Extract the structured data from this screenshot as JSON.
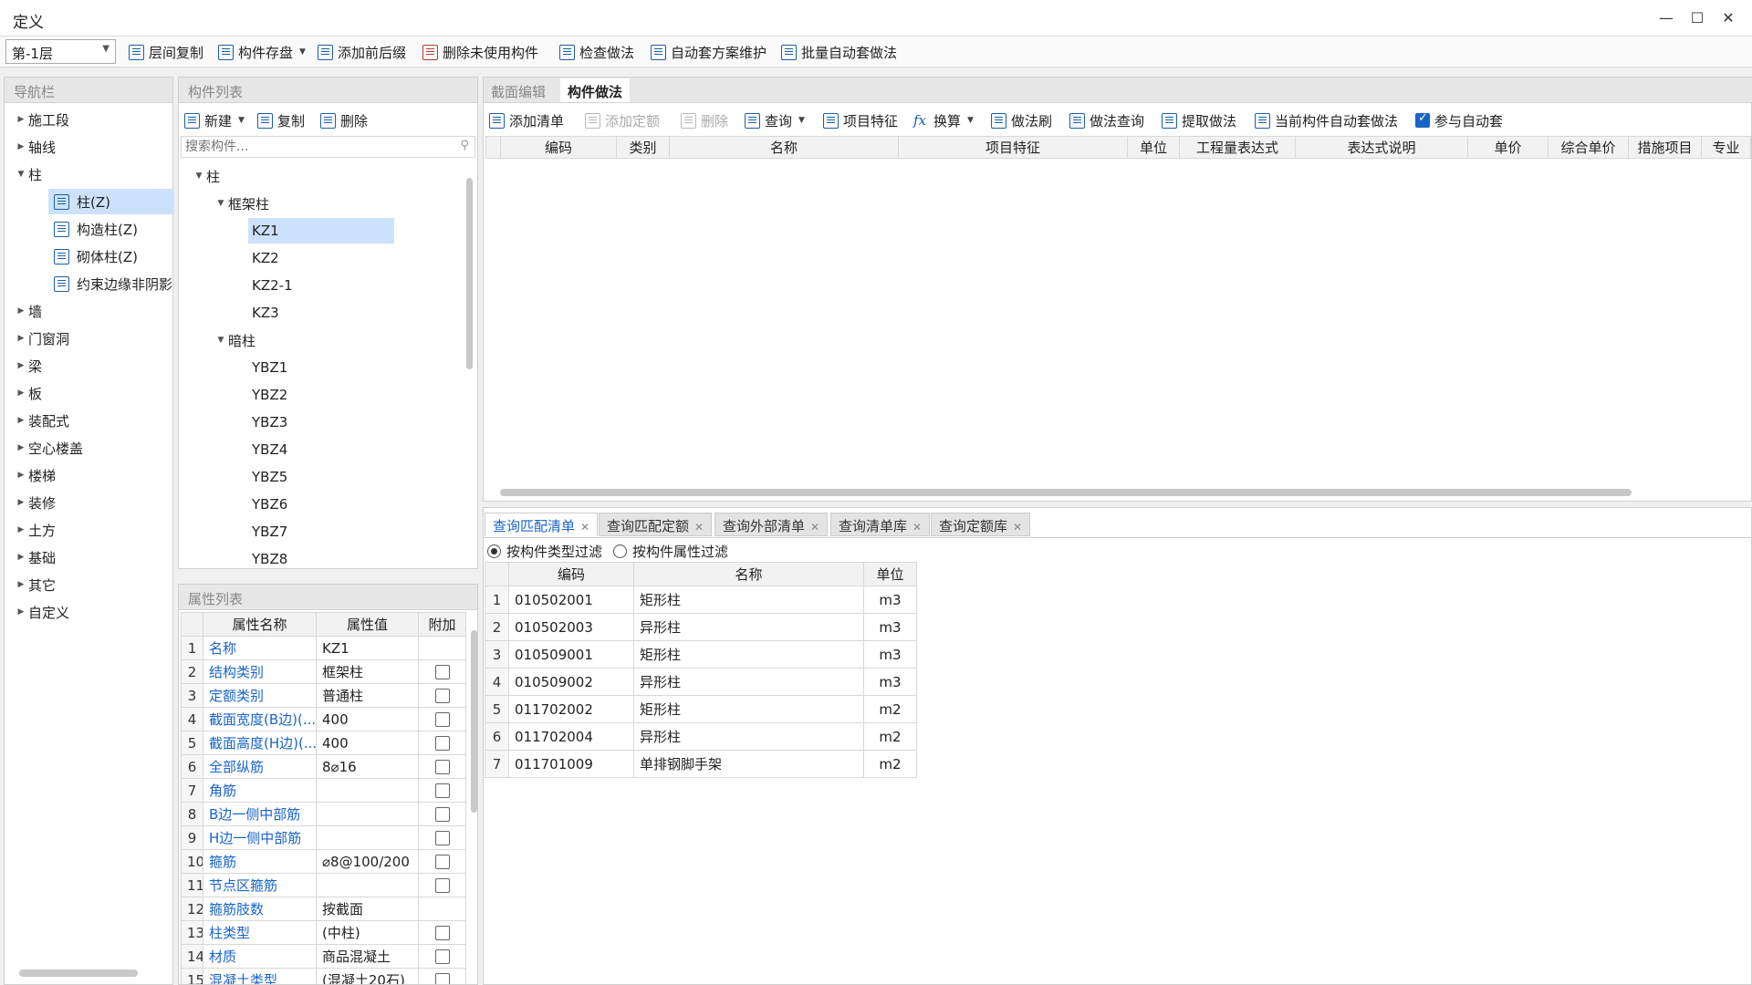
{
  "window": {
    "title": "定义"
  },
  "toolbar": {
    "floor": "第-1层",
    "buttons": [
      "层间复制",
      "构件存盘",
      "添加前后缀",
      "删除未使用构件",
      "检查做法",
      "自动套方案维护",
      "批量自动套做法"
    ]
  },
  "nav": {
    "title": "导航栏",
    "items": [
      "施工段",
      "轴线",
      "柱",
      "柱(Z)",
      "构造柱(Z)",
      "砌体柱(Z)",
      "约束边缘非阴影",
      "墙",
      "门窗洞",
      "梁",
      "板",
      "装配式",
      "空心楼盖",
      "楼梯",
      "装修",
      "土方",
      "基础",
      "其它",
      "自定义"
    ]
  },
  "components": {
    "title": "构件列表",
    "new_label": "新建",
    "copy_label": "复制",
    "delete_label": "删除",
    "search_placeholder": "搜索构件...",
    "root": "柱",
    "group1": "框架柱",
    "group1_items": [
      "KZ1",
      "KZ2",
      "KZ2-1",
      "KZ3"
    ],
    "group2": "暗柱",
    "group2_items": [
      "YBZ1",
      "YBZ2",
      "YBZ3",
      "YBZ4",
      "YBZ5",
      "YBZ6",
      "YBZ7",
      "YBZ8"
    ]
  },
  "props": {
    "title": "属性列表",
    "headers": [
      "属性名称",
      "属性值",
      "附加"
    ],
    "rows": [
      {
        "n": "1",
        "name": "名称",
        "value": "KZ1",
        "cb": false
      },
      {
        "n": "2",
        "name": "结构类别",
        "value": "框架柱",
        "cb": true
      },
      {
        "n": "3",
        "name": "定额类别",
        "value": "普通柱",
        "cb": true
      },
      {
        "n": "4",
        "name": "截面宽度(B边)(...",
        "value": "400",
        "cb": true
      },
      {
        "n": "5",
        "name": "截面高度(H边)(...",
        "value": "400",
        "cb": true
      },
      {
        "n": "6",
        "name": "全部纵筋",
        "value": "8⌀16",
        "cb": true
      },
      {
        "n": "7",
        "name": "角筋",
        "value": "",
        "cb": true
      },
      {
        "n": "8",
        "name": "B边一侧中部筋",
        "value": "",
        "cb": true
      },
      {
        "n": "9",
        "name": "H边一侧中部筋",
        "value": "",
        "cb": true
      },
      {
        "n": "10",
        "name": "箍筋",
        "value": "⌀8@100/200",
        "cb": true
      },
      {
        "n": "11",
        "name": "节点区箍筋",
        "value": "",
        "cb": true
      },
      {
        "n": "12",
        "name": "箍筋肢数",
        "value": "按截面",
        "cb": false
      },
      {
        "n": "13",
        "name": "柱类型",
        "value": "(中柱)",
        "cb": true
      },
      {
        "n": "14",
        "name": "材质",
        "value": "商品混凝土",
        "cb": true
      },
      {
        "n": "15",
        "name": "混凝土类型",
        "value": "(混凝土20石)",
        "cb": true
      }
    ]
  },
  "method": {
    "tabs": [
      "截面编辑",
      "构件做法"
    ],
    "toolbar": [
      "添加清单",
      "添加定额",
      "删除",
      "查询",
      "项目特征",
      "换算",
      "做法刷",
      "做法查询",
      "提取做法",
      "当前构件自动套做法",
      "参与自动套"
    ],
    "headers": [
      "编码",
      "类别",
      "名称",
      "项目特征",
      "单位",
      "工程量表达式",
      "表达式说明",
      "单价",
      "综合单价",
      "措施项目",
      "专业"
    ]
  },
  "query": {
    "tabs": [
      "查询匹配清单",
      "查询匹配定额",
      "查询外部清单",
      "查询清单库",
      "查询定额库"
    ],
    "filter1": "按构件类型过滤",
    "filter2": "按构件属性过滤",
    "headers": [
      "编码",
      "名称",
      "单位"
    ],
    "rows": [
      {
        "n": "1",
        "code": "010502001",
        "name": "矩形柱",
        "unit": "m3"
      },
      {
        "n": "2",
        "code": "010502003",
        "name": "异形柱",
        "unit": "m3"
      },
      {
        "n": "3",
        "code": "010509001",
        "name": "矩形柱",
        "unit": "m3"
      },
      {
        "n": "4",
        "code": "010509002",
        "name": "异形柱",
        "unit": "m3"
      },
      {
        "n": "5",
        "code": "011702002",
        "name": "矩形柱",
        "unit": "m2"
      },
      {
        "n": "6",
        "code": "011702004",
        "name": "异形柱",
        "unit": "m2"
      },
      {
        "n": "7",
        "code": "011701009",
        "name": "单排钢脚手架",
        "unit": "m2"
      }
    ]
  }
}
